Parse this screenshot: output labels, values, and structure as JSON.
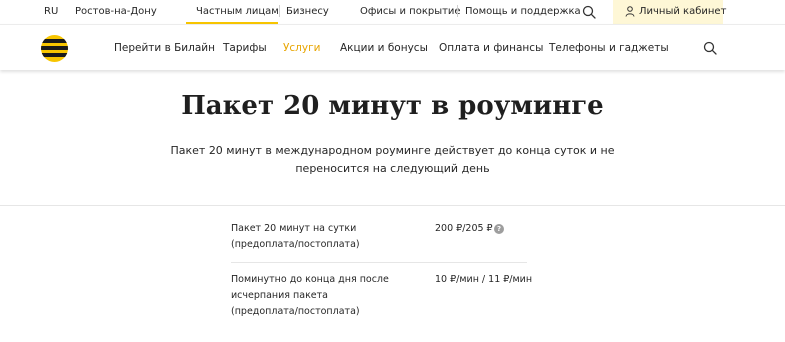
{
  "topbar": {
    "lang": "RU",
    "region": "Ростов-на-Дону",
    "private": "Частным лицам",
    "business": "Бизнесу",
    "offices": "Офисы и покрытие",
    "help": "Помощь и поддержка",
    "cabinet": "Личный кабинет"
  },
  "nav": {
    "items": [
      {
        "label": "Перейти в Билайн"
      },
      {
        "label": "Тарифы"
      },
      {
        "label": "Услуги"
      },
      {
        "label": "Акции и бонусы"
      },
      {
        "label": "Оплата и финансы"
      },
      {
        "label": "Телефоны и гаджеты"
      }
    ],
    "active_index": 2
  },
  "hero": {
    "title": "Пакет 20 минут в роуминге",
    "subtitle_line1": "Пакет 20 минут в международном роуминге действует до конца суток и не",
    "subtitle_line2": "переносится на следующий день"
  },
  "table": {
    "rows": [
      {
        "label_lines": [
          "Пакет 20 минут на сутки",
          "(предоплата/постоплата)"
        ],
        "value": "200 ₽/205 ₽",
        "info": "?"
      },
      {
        "label_lines": [
          "Поминутно до конца дня после",
          "исчерпания пакета",
          "(предоплата/постоплата)"
        ],
        "value": "10 ₽/мин / 11 ₽/мин"
      }
    ]
  },
  "colors": {
    "brand_yellow": "#f7c500",
    "active_link": "#e8a500",
    "cabinet_bg": "#fef7d6"
  },
  "icons": {
    "search": "search-icon",
    "user": "user-icon",
    "info": "info-icon",
    "logo": "beeline-logo"
  }
}
